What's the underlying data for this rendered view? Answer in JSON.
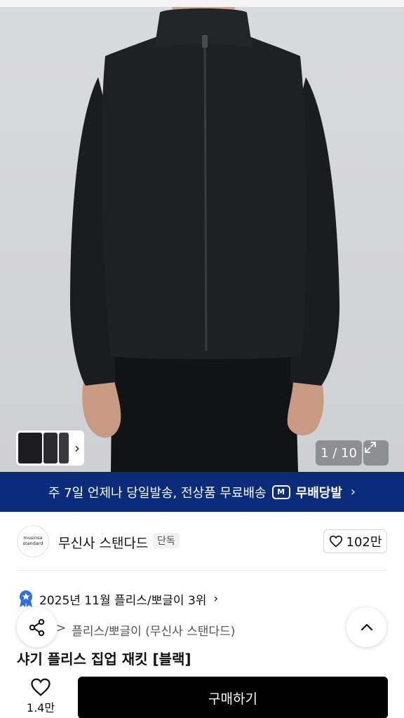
{
  "gallery": {
    "counter": "1 / 10"
  },
  "banner": {
    "text": "주 7일 언제나 당일발송, 전상품 무료배송",
    "logo_mark": "M",
    "brand": "무배당발",
    "color": "#0b2c7a"
  },
  "brand": {
    "logo_line1": "musinsa",
    "logo_line2": "standard",
    "name": "무신사 스탠다드",
    "badge": "단독",
    "likes": "102만"
  },
  "ranking": {
    "text": "2025년 11월 플리스/뽀글이 3위",
    "icon": "ranking-medal-icon",
    "icon_color": "#2f6fe4"
  },
  "category": {
    "separator": ">",
    "path": "플리스/뽀글이 (무신사 스탠다드)"
  },
  "product": {
    "title": "샤기 플리스 집업 재킷 [블랙]"
  },
  "bottom_bar": {
    "wish_count": "1.4만",
    "buy_label": "구매하기"
  }
}
